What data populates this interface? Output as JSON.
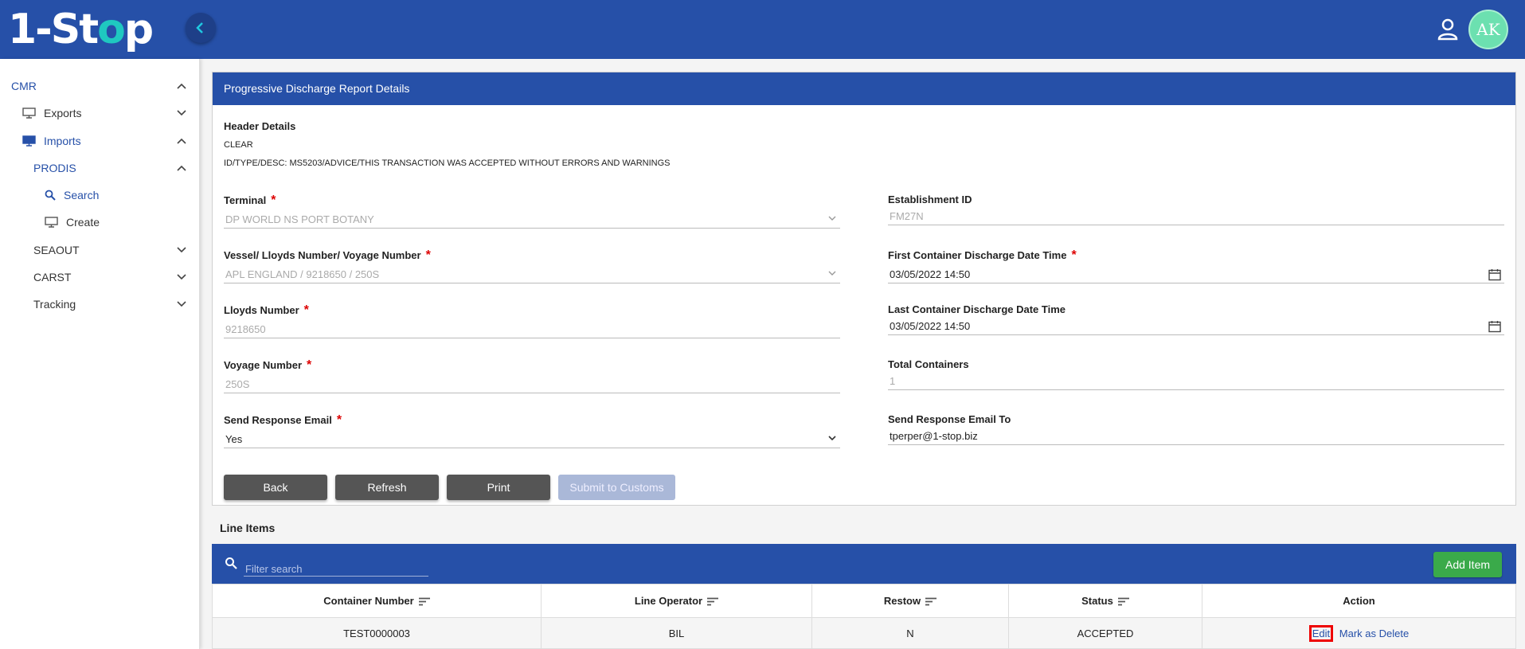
{
  "app": {
    "logo_text_1": "1-St",
    "logo_text_o": "o",
    "logo_text_2": "p",
    "avatar_initials": "AK"
  },
  "sidebar": {
    "cmr": "CMR",
    "exports": "Exports",
    "imports": "Imports",
    "prodis": "PRODIS",
    "search": "Search",
    "create": "Create",
    "seaout": "SEAOUT",
    "carst": "CARST",
    "tracking": "Tracking"
  },
  "card": {
    "title": "Progressive Discharge Report Details",
    "header_details": "Header Details",
    "status_line": "CLEAR",
    "desc_line": "ID/TYPE/DESC: MS5203/ADVICE/THIS TRANSACTION WAS ACCEPTED WITHOUT ERRORS AND WARNINGS"
  },
  "fields": {
    "terminal": {
      "label": "Terminal",
      "value": "DP WORLD NS PORT BOTANY"
    },
    "vessel": {
      "label": "Vessel/ Lloyds Number/ Voyage Number",
      "value": "APL ENGLAND / 9218650 / 250S"
    },
    "lloyds": {
      "label": "Lloyds Number",
      "value": "9218650"
    },
    "voyage": {
      "label": "Voyage Number",
      "value": "250S"
    },
    "send_email": {
      "label": "Send Response Email",
      "value": "Yes"
    },
    "establishment": {
      "label": "Establishment ID",
      "value": "FM27N"
    },
    "first_discharge": {
      "label": "First Container Discharge Date Time",
      "value": "03/05/2022 14:50"
    },
    "last_discharge": {
      "label": "Last Container Discharge Date Time",
      "value": "03/05/2022 14:50"
    },
    "total_containers": {
      "label": "Total Containers",
      "value": "1"
    },
    "email_to": {
      "label": "Send Response Email To",
      "value": "tperper@1-stop.biz"
    }
  },
  "buttons": {
    "back": "Back",
    "refresh": "Refresh",
    "print": "Print",
    "submit": "Submit to Customs"
  },
  "line_items": {
    "title": "Line Items",
    "filter_placeholder": "Filter search",
    "add_item": "Add Item",
    "columns": [
      "Container Number",
      "Line Operator",
      "Restow",
      "Status",
      "Action"
    ],
    "rows": [
      {
        "container": "TEST0000003",
        "operator": "BIL",
        "restow": "N",
        "status": "ACCEPTED",
        "edit": "Edit",
        "delete": "Mark as Delete"
      }
    ]
  },
  "colors": {
    "primary": "#2650a8",
    "success": "#3aaa4a",
    "required": "#dd0000"
  }
}
